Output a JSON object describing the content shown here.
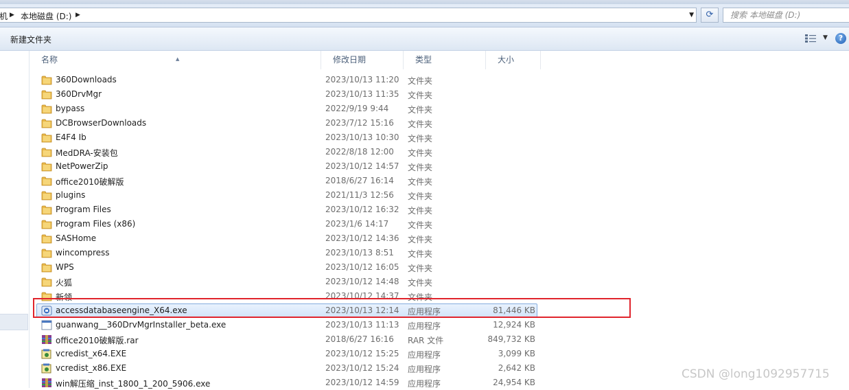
{
  "address": {
    "fragment": "机",
    "location": "本地磁盘 (D:)"
  },
  "search": {
    "placeholder": "搜索 本地磁盘 (D:)"
  },
  "toolbar": {
    "new_folder": "新建文件夹",
    "help": "?"
  },
  "columns": {
    "name": "名称",
    "date": "修改日期",
    "type": "类型",
    "size": "大小"
  },
  "colors": {
    "selection_border": "#84acdd",
    "highlight_box": "#e0242c",
    "folder": "#e8b84a"
  },
  "files": [
    {
      "name": "360Downloads",
      "date": "2023/10/13 11:20",
      "type": "文件夹",
      "size": "",
      "icon": "folder-icon"
    },
    {
      "name": "360DrvMgr",
      "date": "2023/10/13 11:35",
      "type": "文件夹",
      "size": "",
      "icon": "folder-icon"
    },
    {
      "name": "bypass",
      "date": "2022/9/19 9:44",
      "type": "文件夹",
      "size": "",
      "icon": "folder-icon"
    },
    {
      "name": "DCBrowserDownloads",
      "date": "2023/7/12 15:16",
      "type": "文件夹",
      "size": "",
      "icon": "folder-icon"
    },
    {
      "name": "E4F4 Ib",
      "date": "2023/10/13 10:30",
      "type": "文件夹",
      "size": "",
      "icon": "folder-icon"
    },
    {
      "name": "MedDRA-安装包",
      "date": "2022/8/18 12:00",
      "type": "文件夹",
      "size": "",
      "icon": "folder-icon"
    },
    {
      "name": "NetPowerZip",
      "date": "2023/10/12 14:57",
      "type": "文件夹",
      "size": "",
      "icon": "folder-icon"
    },
    {
      "name": "office2010破解版",
      "date": "2018/6/27 16:14",
      "type": "文件夹",
      "size": "",
      "icon": "folder-icon"
    },
    {
      "name": "plugins",
      "date": "2021/11/3 12:56",
      "type": "文件夹",
      "size": "",
      "icon": "folder-icon"
    },
    {
      "name": "Program Files",
      "date": "2023/10/12 16:32",
      "type": "文件夹",
      "size": "",
      "icon": "folder-icon"
    },
    {
      "name": "Program Files (x86)",
      "date": "2023/1/6 14:17",
      "type": "文件夹",
      "size": "",
      "icon": "folder-icon"
    },
    {
      "name": "SASHome",
      "date": "2023/10/12 14:36",
      "type": "文件夹",
      "size": "",
      "icon": "folder-icon"
    },
    {
      "name": "wincompress",
      "date": "2023/10/13 8:51",
      "type": "文件夹",
      "size": "",
      "icon": "folder-icon"
    },
    {
      "name": "WPS",
      "date": "2023/10/12 16:05",
      "type": "文件夹",
      "size": "",
      "icon": "folder-icon"
    },
    {
      "name": "火狐",
      "date": "2023/10/12 14:48",
      "type": "文件夹",
      "size": "",
      "icon": "folder-icon"
    },
    {
      "name": "新领",
      "date": "2023/10/12 14:37",
      "type": "文件夹",
      "size": "",
      "icon": "folder-icon"
    },
    {
      "name": "accessdatabaseengine_X64.exe",
      "date": "2023/10/13 12:14",
      "type": "应用程序",
      "size": "81,446 KB",
      "icon": "installer-icon",
      "selected": true
    },
    {
      "name": "guanwang__360DrvMgrInstaller_beta.exe",
      "date": "2023/10/13 11:13",
      "type": "应用程序",
      "size": "12,924 KB",
      "icon": "app-icon"
    },
    {
      "name": "office2010破解版.rar",
      "date": "2018/6/27 16:16",
      "type": "RAR 文件",
      "size": "849,732 KB",
      "icon": "rar-icon"
    },
    {
      "name": "vcredist_x64.EXE",
      "date": "2023/10/12 15:25",
      "type": "应用程序",
      "size": "3,099 KB",
      "icon": "setup-icon"
    },
    {
      "name": "vcredist_x86.EXE",
      "date": "2023/10/12 15:24",
      "type": "应用程序",
      "size": "2,642 KB",
      "icon": "setup-icon"
    },
    {
      "name": "win解压缩_inst_1800_1_200_5906.exe",
      "date": "2023/10/12 14:59",
      "type": "应用程序",
      "size": "24,954 KB",
      "icon": "rar-icon"
    }
  ],
  "watermark": "CSDN @long1092957715"
}
